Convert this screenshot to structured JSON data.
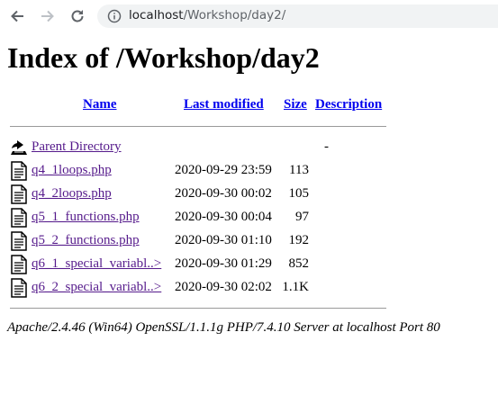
{
  "browser": {
    "url_host": "localhost",
    "url_path": "/Workshop/day2/"
  },
  "page": {
    "title": "Index of /Workshop/day2"
  },
  "table": {
    "headers": {
      "name": "Name",
      "last_modified": "Last modified",
      "size": "Size",
      "description": "Description"
    },
    "parent": {
      "label": "Parent Directory",
      "size": "-"
    },
    "rows": [
      {
        "name": "q4_1loops.php",
        "modified": "2020-09-29 23:59",
        "size": "113",
        "icon": "text-file-icon"
      },
      {
        "name": "q4_2loops.php",
        "modified": "2020-09-30 00:02",
        "size": "105",
        "icon": "text-file-icon"
      },
      {
        "name": "q5_1_functions.php",
        "modified": "2020-09-30 00:04",
        "size": "97",
        "icon": "text-file-icon"
      },
      {
        "name": "q5_2_functions.php",
        "modified": "2020-09-30 01:10",
        "size": "192",
        "icon": "text-file-icon"
      },
      {
        "name": "q6_1_special_variabl..>",
        "modified": "2020-09-30 01:29",
        "size": "852",
        "icon": "text-file-icon"
      },
      {
        "name": "q6_2_special_variabl..>",
        "modified": "2020-09-30 02:02",
        "size": "1.1K",
        "icon": "text-file-icon"
      }
    ]
  },
  "footer": {
    "server": "Apache/2.4.46 (Win64) OpenSSL/1.1.1g PHP/7.4.10 Server at localhost Port 80"
  }
}
